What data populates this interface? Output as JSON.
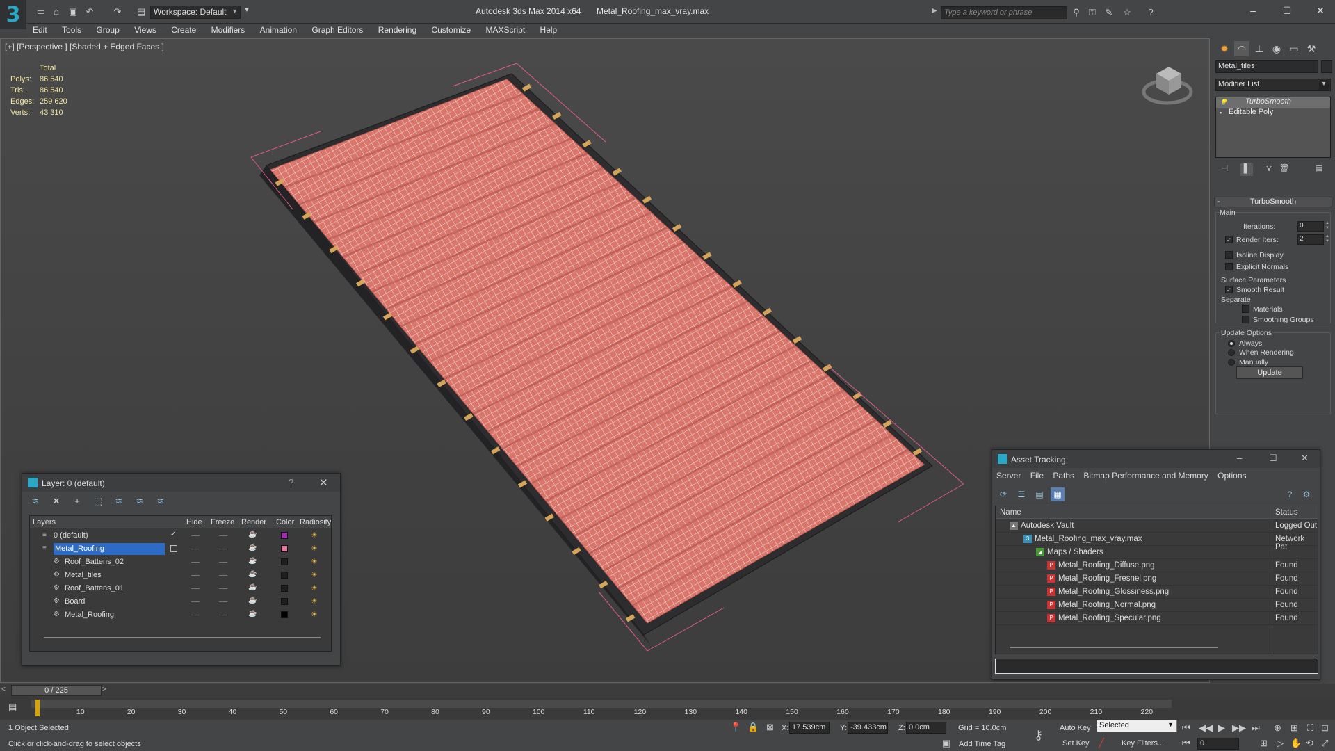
{
  "titlebar": {
    "workspace": "Workspace: Default",
    "app_title": "Autodesk 3ds Max  2014 x64",
    "file_title": "Metal_Roofing_max_vray.max",
    "search_placeholder": "Type a keyword or phrase"
  },
  "menu": [
    "Edit",
    "Tools",
    "Group",
    "Views",
    "Create",
    "Modifiers",
    "Animation",
    "Graph Editors",
    "Rendering",
    "Customize",
    "MAXScript",
    "Help"
  ],
  "viewport": {
    "label": "[+] [Perspective ] [Shaded + Edged Faces ]",
    "stats_header": "Total",
    "stats": [
      {
        "k": "Polys:",
        "v": "86 540"
      },
      {
        "k": "Tris:",
        "v": "86 540"
      },
      {
        "k": "Edges:",
        "v": "259 620"
      },
      {
        "k": "Verts:",
        "v": "43 310"
      }
    ],
    "roof_color": "#d9766c",
    "selection_color": "#e05a8a"
  },
  "command_panel": {
    "object_name": "Metal_tiles",
    "modifier_list": "Modifier List",
    "stack": [
      "TurboSmooth",
      "Editable Poly"
    ],
    "rollout_title": "TurboSmooth",
    "main_label": "Main",
    "iterations_label": "Iterations:",
    "iterations_value": "0",
    "render_iters_label": "Render Iters:",
    "render_iters_value": "2",
    "isoline_label": "Isoline Display",
    "explicit_normals_label": "Explicit Normals",
    "surface_params_label": "Surface Parameters",
    "smooth_result_label": "Smooth Result",
    "separate_label": "Separate",
    "materials_label": "Materials",
    "smoothing_groups_label": "Smoothing Groups",
    "update_options_label": "Update Options",
    "always_label": "Always",
    "when_rendering_label": "When Rendering",
    "manually_label": "Manually",
    "update_button": "Update"
  },
  "layer_dialog": {
    "title": "Layer: 0 (default)",
    "help": "?",
    "columns": [
      "Layers",
      "Hide",
      "Freeze",
      "Render",
      "Color",
      "Radiosity"
    ],
    "rows": [
      {
        "name": "0 (default)",
        "color": "#9b2fae",
        "level": 0
      },
      {
        "name": "Metal_Roofing",
        "color": "#e07aa0",
        "level": 0
      },
      {
        "name": "Roof_Battens_02",
        "color": "#1e1e1e",
        "level": 1
      },
      {
        "name": "Metal_tiles",
        "color": "#1e1e1e",
        "level": 1
      },
      {
        "name": "Roof_Battens_01",
        "color": "#1e1e1e",
        "level": 1
      },
      {
        "name": "Board",
        "color": "#1e1e1e",
        "level": 1
      },
      {
        "name": "Metal_Roofing",
        "color": "#000000",
        "level": 1
      }
    ]
  },
  "asset_dialog": {
    "title": "Asset Tracking",
    "menu": [
      "Server",
      "File",
      "Paths",
      "Bitmap Performance and Memory",
      "Options"
    ],
    "col_name": "Name",
    "col_status": "Status",
    "rows": [
      {
        "name": "Autodesk Vault",
        "status": "Logged Out",
        "indent": 1
      },
      {
        "name": "Metal_Roofing_max_vray.max",
        "status": "Network Pat",
        "indent": 2
      },
      {
        "name": "Maps / Shaders",
        "status": "",
        "indent": 3
      },
      {
        "name": "Metal_Roofing_Diffuse.png",
        "status": "Found",
        "indent": 4
      },
      {
        "name": "Metal_Roofing_Fresnel.png",
        "status": "Found",
        "indent": 4
      },
      {
        "name": "Metal_Roofing_Glossiness.png",
        "status": "Found",
        "indent": 4
      },
      {
        "name": "Metal_Roofing_Normal.png",
        "status": "Found",
        "indent": 4
      },
      {
        "name": "Metal_Roofing_Specular.png",
        "status": "Found",
        "indent": 4
      }
    ]
  },
  "timeline": {
    "slider": "0 / 225",
    "ticks": [
      "10",
      "20",
      "30",
      "40",
      "50",
      "60",
      "70",
      "80",
      "90",
      "100",
      "110",
      "120",
      "130",
      "140",
      "150",
      "160",
      "170",
      "180",
      "190",
      "200",
      "210",
      "220"
    ]
  },
  "status": {
    "selected": "1 Object Selected",
    "prompt": "Click or click-and-drag to select objects",
    "x_label": "X:",
    "x": "17.539cm",
    "y_label": "Y:",
    "y": "-39.433cm",
    "z_label": "Z:",
    "z": "0.0cm",
    "grid": "Grid = 10.0cm",
    "add_time_tag": "Add Time Tag",
    "auto_key": "Auto Key",
    "set_key": "Set Key",
    "selected_dropdown": "Selected",
    "key_filters": "Key Filters...",
    "frame": "0"
  }
}
